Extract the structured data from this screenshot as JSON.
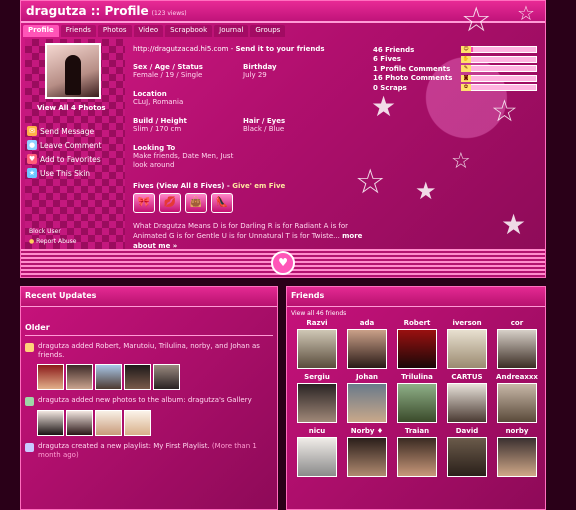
{
  "profile": {
    "name_title": "dragutza :: Profile",
    "views": "(123 views)",
    "tabs": [
      "Profile",
      "Friends",
      "Photos",
      "Video",
      "Scrapbook",
      "Journal",
      "Groups"
    ],
    "view_all_photos": "View All 4 Photos",
    "actions": [
      {
        "label": "Send Message",
        "icon": "envelope-icon",
        "color": "#ffb347"
      },
      {
        "label": "Leave Comment",
        "icon": "comment-icon",
        "color": "#8fd0ff"
      },
      {
        "label": "Add to Favorites",
        "icon": "heart-icon",
        "color": "#ff5f7a"
      },
      {
        "label": "Use This Skin",
        "icon": "star-icon",
        "color": "#6cc6ff"
      }
    ],
    "block_user": "Block User",
    "report_abuse": "Report Abuse",
    "url": "http://dragutzacad.hi5.com",
    "url_sep": " - ",
    "send_to_friends": "Send it to your friends",
    "sex_age_status_label": "Sex / Age / Status",
    "sex_age_status": "Female / 19 / Single",
    "birthday_label": "Birthday",
    "birthday": "July 29",
    "location_label": "Location",
    "location": "CLuJ, Romania",
    "build_height_label": "Build / Height",
    "build_height": "Slim / 170 cm",
    "hair_eyes_label": "Hair / Eyes",
    "hair_eyes": "Black / Blue",
    "looking_to_label": "Looking To",
    "looking_to": "Make friends, Date Men, Just look around",
    "fives_prefix": "Fives",
    "fives_link": "(View All 8 Fives)",
    "fives_sep": " - ",
    "give_five": "Give' em Five",
    "fives_icons": [
      "bow-icon",
      "lips-icon",
      "bag-icon",
      "shoe-icon"
    ],
    "means_text": "What Dragutza Means D is for Darling R is for Radiant A is for Animated G is for Gentle U is for Unnatural T is for Twiste...",
    "more_about": "more about me »"
  },
  "stats": [
    {
      "label": "46 Friends",
      "fill": 0.15,
      "icon": "smiley-icon"
    },
    {
      "label": "6 Fives",
      "fill": 0.12,
      "icon": "hand-icon"
    },
    {
      "label": "1 Profile Comments",
      "fill": 0.05,
      "icon": "comment-icon"
    },
    {
      "label": "16 Photo Comments",
      "fill": 0.1,
      "icon": "camera-icon"
    },
    {
      "label": "0 Scraps",
      "fill": 0.03,
      "icon": "scrap-icon"
    }
  ],
  "recent": {
    "title": "Recent Updates",
    "older": "Older",
    "updates": [
      {
        "icon": "friends-icon",
        "text": "dragutza added Robert, Marutoiu, Trilulina, norby, and Johan as friends.",
        "more": ""
      },
      {
        "icon": "photo-icon",
        "text": "dragutza added new photos to the album: dragutza's Gallery",
        "more": ""
      },
      {
        "icon": "music-icon",
        "text": "dragutza created a new playlist: My First Playlist.",
        "more": "(More than 1 month ago)"
      }
    ]
  },
  "friends": {
    "title": "Friends",
    "view_all": "View all 46 friends",
    "list": [
      "Razvi",
      "ada",
      "Robert",
      "iverson",
      "cor",
      "Sergiu",
      "Johan",
      "Trilulina",
      "CARTUS",
      "Andreaxxx",
      "nicu",
      "Norby ♦",
      "Traian",
      "David",
      "norby"
    ]
  },
  "colors": {
    "accent": "#ff4aab",
    "bg": "#c8127c"
  }
}
